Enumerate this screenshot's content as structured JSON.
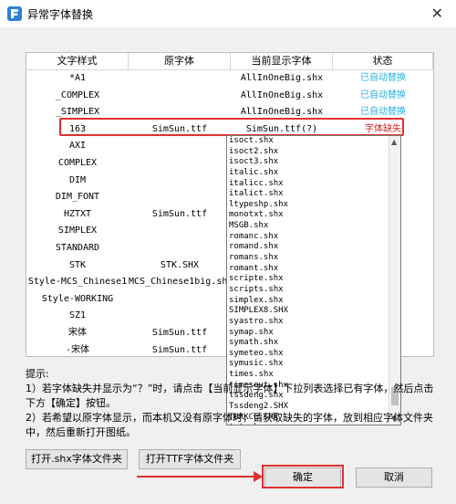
{
  "window": {
    "title": "异常字体替换",
    "close_glyph": "✕"
  },
  "table": {
    "headers": [
      "文字样式",
      "原字体",
      "当前显示字体",
      "状态"
    ],
    "rows": [
      [
        "*A1",
        "",
        "AllInOneBig.shx",
        "已自动替换"
      ],
      [
        "_COMPLEX",
        "",
        "AllInOneBig.shx",
        "已自动替换"
      ],
      [
        "_SIMPLEX",
        "",
        "AllInOneBig.shx",
        "已自动替换"
      ],
      [
        "163",
        "SimSun.ttf",
        "SimSun.ttf(?)",
        "字体缺失"
      ],
      [
        "AXI",
        "",
        "",
        ""
      ],
      [
        "COMPLEX",
        "",
        "",
        ""
      ],
      [
        "DIM",
        "",
        "",
        ""
      ],
      [
        "DIM_FONT",
        "",
        "",
        ""
      ],
      [
        "HZTXT",
        "SimSun.ttf",
        "",
        ""
      ],
      [
        "SIMPLEX",
        "",
        "",
        ""
      ],
      [
        "STANDARD",
        "",
        "",
        ""
      ],
      [
        "STK",
        "STK.SHX",
        "",
        ""
      ],
      [
        "Style-MCS_Chinese1",
        "MCS_Chinese1big.shx",
        "",
        ""
      ],
      [
        "Style-WORKING",
        "",
        "",
        ""
      ],
      [
        "SZ1",
        "",
        "",
        ""
      ],
      [
        "宋体",
        "SimSun.ttf",
        "",
        ""
      ],
      [
        "-宋体",
        "SimSun.ttf",
        "",
        ""
      ]
    ]
  },
  "dropdown": {
    "options": [
      "isoct.shx",
      "isoct2.shx",
      "isoct3.shx",
      "italic.shx",
      "italicc.shx",
      "italict.shx",
      "ltypeshp.shx",
      "monotxt.shx",
      "MSGB.shx",
      "romanc.shx",
      "romand.shx",
      "romans.shx",
      "romant.shx",
      "scripte.shx",
      "scripts.shx",
      "simplex.shx",
      "SIMPLEX8.SHX",
      "syastro.shx",
      "symap.shx",
      "symath.shx",
      "symeteo.shx",
      "symusic.shx",
      "times.shx",
      "timesout.shx",
      "tssdeng.shx",
      "Tssdeng2.SHX",
      "TURKCE.SHX",
      "txt.shx",
      "txt1.shx",
      "SimSun.ttf(?)"
    ],
    "selected_index": 29
  },
  "tips": {
    "heading": "提示:",
    "line1": "1）若字体缺失并显示为“？”时，请点击【当前显示字体】下拉列表选择已有字体，然后点击下方【确定】按钮。",
    "line2": "2）若希望以原字体显示，而本机又没有原字体时，请获取缺失的字体，放到相应字体文件夹中，然后重新打开图纸。"
  },
  "buttons": {
    "open_shx": "打开.shx字体文件夹",
    "open_ttf": "打开TTF字体文件夹",
    "ok": "确定",
    "cancel": "取消"
  },
  "colors": {
    "status_ok": "#2ab0e0",
    "status_missing": "#d02020",
    "highlight": "#e03030",
    "selection": "#1e72c8"
  }
}
